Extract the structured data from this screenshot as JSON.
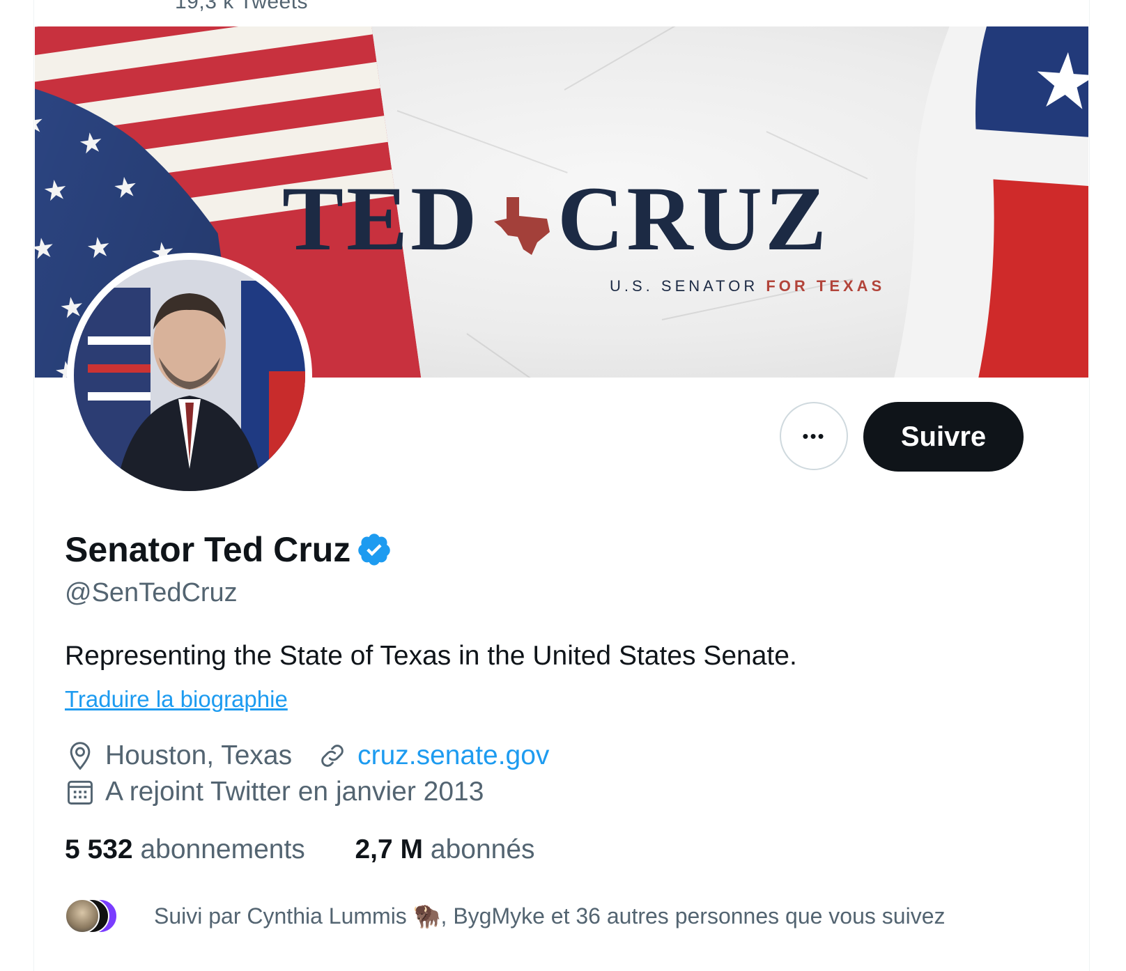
{
  "header": {
    "tweet_count": "19,3 k Tweets"
  },
  "banner": {
    "word_left": "TED",
    "word_right": "CRUZ",
    "subtitle_plain": "U.S. SENATOR ",
    "subtitle_accent": "FOR TEXAS"
  },
  "actions": {
    "more_label": "•••",
    "follow_label": "Suivre"
  },
  "profile": {
    "name": "Senator Ted Cruz",
    "handle": "@SenTedCruz",
    "bio": "Representing the State of Texas in the United States Senate.",
    "translate_link": "Traduire la biographie",
    "location": "Houston, Texas",
    "website": "cruz.senate.gov",
    "joined": "A rejoint Twitter en janvier 2013"
  },
  "stats": {
    "following_count": "5 532",
    "following_label": "abonnements",
    "followers_count": "2,7 M",
    "followers_label": "abonnés"
  },
  "followed_by": {
    "text_prefix": "Suivi par Cynthia Lummis ",
    "emoji": "🦬",
    "text_suffix": ", BygMyke et 36 autres personnes que vous suivez"
  },
  "colors": {
    "accent": "#1d9bf0",
    "text_primary": "#0f1419",
    "text_secondary": "#536471",
    "follow_bg": "#0f1419"
  }
}
